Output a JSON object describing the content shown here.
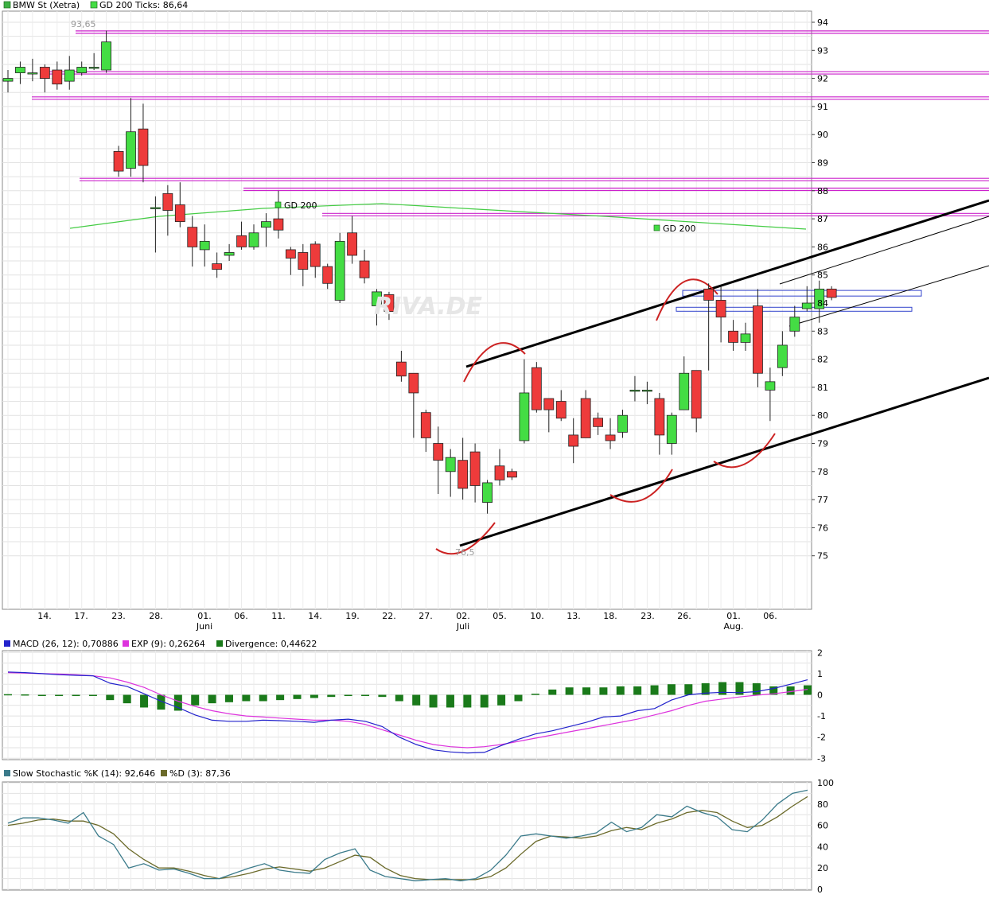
{
  "chart_data": [
    {
      "type": "candlestick",
      "legend": [
        {
          "label": "BMW St (Xetra)",
          "color": "#2e8b2e"
        },
        {
          "label": "GD 200 Ticks: 86,64",
          "color": "#44cc44"
        }
      ],
      "yticks": [
        "94",
        "93",
        "92",
        "91",
        "90",
        "89",
        "88",
        "87",
        "86",
        "85",
        "84",
        "83",
        "82",
        "81",
        "80",
        "79",
        "78",
        "77",
        "76",
        "75"
      ],
      "xticks": [
        "14.",
        "17.",
        "23.",
        "28.",
        "01.",
        "06.",
        "11.",
        "14.",
        "19.",
        "22.",
        "27.",
        "02.",
        "05.",
        "10.",
        "13.",
        "18.",
        "23.",
        "26.",
        "01.",
        "06."
      ],
      "month_labels": [
        "Juni",
        "Juli",
        "Aug."
      ],
      "annotations": {
        "high": "93,65",
        "low": "76,5",
        "gd200_a": "GD 200",
        "gd200_b": "GD 200",
        "watermark": "RIVA.DE"
      },
      "candles": [
        [
          91.9,
          92.3,
          91.5,
          92.0
        ],
        [
          92.2,
          92.6,
          91.8,
          92.4
        ],
        [
          92.2,
          92.7,
          91.9,
          92.2
        ],
        [
          92.4,
          92.5,
          91.5,
          92.0
        ],
        [
          92.3,
          92.6,
          91.6,
          91.8
        ],
        [
          91.9,
          92.8,
          91.6,
          92.3
        ],
        [
          92.2,
          92.6,
          92.1,
          92.4
        ],
        [
          92.4,
          92.9,
          92.3,
          92.4
        ],
        [
          92.3,
          93.7,
          92.2,
          93.3
        ],
        [
          89.4,
          89.6,
          88.5,
          88.7
        ],
        [
          88.8,
          91.3,
          88.5,
          90.1
        ],
        [
          90.2,
          91.1,
          88.3,
          88.9
        ],
        [
          87.4,
          87.8,
          85.8,
          87.4
        ],
        [
          87.9,
          88.2,
          86.4,
          87.3
        ],
        [
          87.5,
          88.3,
          86.7,
          86.9
        ],
        [
          86.7,
          87.1,
          85.3,
          86.0
        ],
        [
          85.9,
          86.8,
          85.3,
          86.2
        ],
        [
          85.4,
          85.8,
          84.9,
          85.2
        ],
        [
          85.7,
          86.1,
          85.5,
          85.8
        ],
        [
          86.4,
          86.9,
          85.9,
          86.0
        ],
        [
          86.0,
          86.8,
          85.9,
          86.5
        ],
        [
          86.7,
          87.2,
          86.0,
          86.9
        ],
        [
          87.0,
          88.0,
          86.3,
          86.6
        ],
        [
          85.9,
          86.0,
          85.0,
          85.6
        ],
        [
          85.8,
          86.1,
          84.6,
          85.2
        ],
        [
          86.1,
          86.2,
          84.9,
          85.3
        ],
        [
          85.3,
          85.4,
          84.5,
          84.7
        ],
        [
          84.1,
          86.5,
          84.0,
          86.2
        ],
        [
          86.5,
          87.1,
          85.4,
          85.7
        ],
        [
          85.5,
          85.9,
          84.7,
          84.9
        ],
        [
          83.9,
          84.5,
          83.2,
          84.4
        ],
        [
          84.3,
          84.4,
          83.4,
          83.7
        ],
        [
          81.9,
          82.3,
          81.2,
          81.4
        ],
        [
          81.5,
          81.5,
          79.2,
          80.8
        ],
        [
          80.1,
          80.2,
          78.7,
          79.2
        ],
        [
          79.0,
          79.6,
          77.2,
          78.4
        ],
        [
          78.0,
          78.8,
          77.1,
          78.5
        ],
        [
          78.4,
          79.2,
          77.0,
          77.4
        ],
        [
          78.7,
          79.0,
          76.9,
          77.5
        ],
        [
          76.9,
          77.7,
          76.5,
          77.6
        ],
        [
          78.2,
          78.8,
          77.5,
          77.7
        ],
        [
          78.0,
          78.1,
          77.7,
          77.8
        ],
        [
          79.1,
          82.0,
          79.0,
          80.8
        ],
        [
          81.7,
          81.9,
          80.1,
          80.2
        ],
        [
          80.6,
          80.6,
          79.4,
          80.2
        ],
        [
          80.5,
          80.9,
          79.8,
          79.9
        ],
        [
          79.3,
          79.9,
          78.3,
          78.9
        ],
        [
          80.6,
          80.9,
          79.4,
          79.2
        ],
        [
          79.9,
          80.1,
          79.3,
          79.6
        ],
        [
          79.3,
          79.9,
          78.8,
          79.1
        ],
        [
          79.4,
          80.2,
          79.2,
          80.0
        ],
        [
          80.9,
          81.4,
          80.5,
          80.9
        ],
        [
          80.9,
          81.2,
          80.4,
          80.9
        ],
        [
          80.6,
          80.8,
          78.6,
          79.3
        ],
        [
          79.0,
          80.1,
          78.6,
          80.0
        ],
        [
          80.2,
          82.1,
          80.2,
          81.5
        ],
        [
          81.6,
          81.6,
          79.4,
          79.9
        ],
        [
          84.5,
          84.7,
          81.6,
          84.1
        ],
        [
          84.1,
          84.6,
          82.6,
          83.5
        ],
        [
          83.0,
          83.4,
          82.3,
          82.6
        ],
        [
          82.6,
          83.3,
          82.3,
          82.9
        ],
        [
          83.9,
          84.5,
          81.0,
          81.5
        ],
        [
          80.9,
          81.7,
          79.8,
          81.2
        ],
        [
          81.7,
          83.0,
          81.4,
          82.5
        ],
        [
          83.0,
          83.9,
          82.8,
          83.5
        ],
        [
          83.8,
          84.6,
          83.7,
          84.0
        ],
        [
          83.8,
          84.8,
          83.3,
          84.5
        ],
        [
          84.5,
          84.6,
          84.1,
          84.2
        ]
      ],
      "resistance_lines": [
        93.65,
        92.2,
        91.3,
        88.4,
        88.05,
        87.15
      ],
      "support_zones": [
        [
          84.25,
          84.45
        ],
        [
          83.75,
          83.85
        ]
      ]
    },
    {
      "type": "bar+line",
      "legend": [
        {
          "label": "MACD (26, 12): 0,70886",
          "color": "#2222cc"
        },
        {
          "label": "EXP (9): 0,26264",
          "color": "#cc33cc"
        },
        {
          "label": "Divergence: 0,44622",
          "color": "#1a7a1a"
        }
      ],
      "yticks": [
        "2",
        "1",
        "0",
        "-1",
        "-2",
        "-3"
      ],
      "macd": [
        1.08,
        1.05,
        1.0,
        0.95,
        0.92,
        0.9,
        0.55,
        0.4,
        0.05,
        -0.3,
        -0.6,
        -0.95,
        -1.2,
        -1.25,
        -1.25,
        -1.2,
        -1.22,
        -1.25,
        -1.3,
        -1.2,
        -1.15,
        -1.25,
        -1.5,
        -2.0,
        -2.35,
        -2.6,
        -2.7,
        -2.75,
        -2.72,
        -2.4,
        -2.1,
        -1.85,
        -1.7,
        -1.5,
        -1.3,
        -1.05,
        -1.0,
        -0.75,
        -0.65,
        -0.25,
        0.0,
        0.08,
        0.12,
        0.1,
        0.15,
        0.3,
        0.5,
        0.71
      ],
      "exp": [
        1.05,
        1.03,
        1.0,
        0.98,
        0.95,
        0.9,
        0.8,
        0.6,
        0.35,
        0.0,
        -0.3,
        -0.55,
        -0.75,
        -0.9,
        -1.0,
        -1.05,
        -1.1,
        -1.15,
        -1.2,
        -1.2,
        -1.25,
        -1.4,
        -1.65,
        -1.9,
        -2.15,
        -2.35,
        -2.45,
        -2.5,
        -2.45,
        -2.35,
        -2.2,
        -2.05,
        -1.9,
        -1.75,
        -1.6,
        -1.45,
        -1.3,
        -1.15,
        -0.95,
        -0.75,
        -0.5,
        -0.3,
        -0.2,
        -0.1,
        -0.02,
        0.05,
        0.15,
        0.26
      ],
      "divergence": [
        0.03,
        0.02,
        0.0,
        -0.03,
        -0.03,
        0.0,
        -0.25,
        -0.4,
        -0.6,
        -0.7,
        -0.75,
        -0.5,
        -0.4,
        -0.35,
        -0.3,
        -0.3,
        -0.25,
        -0.2,
        -0.15,
        -0.1,
        -0.05,
        -0.05,
        -0.1,
        -0.3,
        -0.5,
        -0.6,
        -0.6,
        -0.6,
        -0.6,
        -0.5,
        -0.3,
        0.05,
        0.25,
        0.35,
        0.35,
        0.35,
        0.4,
        0.4,
        0.45,
        0.5,
        0.5,
        0.55,
        0.6,
        0.6,
        0.55,
        0.4,
        0.4,
        0.45
      ]
    },
    {
      "type": "line",
      "legend": [
        {
          "label": "Slow Stochastic %K (14): 92,646",
          "color": "#3a7a8a"
        },
        {
          "label": "%D (3): 87,36",
          "color": "#6b6a2a"
        }
      ],
      "yticks": [
        "100",
        "80",
        "60",
        "40",
        "20",
        "0"
      ],
      "k": [
        62,
        67,
        67,
        65,
        62,
        72,
        50,
        42,
        20,
        24,
        18,
        19,
        15,
        10,
        10,
        15,
        20,
        24,
        18,
        16,
        15,
        28,
        34,
        38,
        18,
        12,
        10,
        8,
        9,
        10,
        8,
        10,
        18,
        32,
        50,
        52,
        50,
        48,
        50,
        53,
        63,
        54,
        58,
        70,
        68,
        78,
        72,
        68,
        56,
        54,
        65,
        80,
        90,
        93
      ],
      "d": [
        60,
        62,
        65,
        66,
        64,
        64,
        60,
        52,
        38,
        28,
        20,
        20,
        17,
        13,
        10,
        12,
        15,
        19,
        21,
        19,
        17,
        20,
        26,
        32,
        30,
        20,
        13,
        10,
        9,
        9,
        9,
        9,
        12,
        20,
        33,
        45,
        50,
        49,
        48,
        50,
        55,
        58,
        56,
        62,
        66,
        72,
        74,
        72,
        64,
        58,
        60,
        68,
        78,
        87
      ]
    }
  ]
}
